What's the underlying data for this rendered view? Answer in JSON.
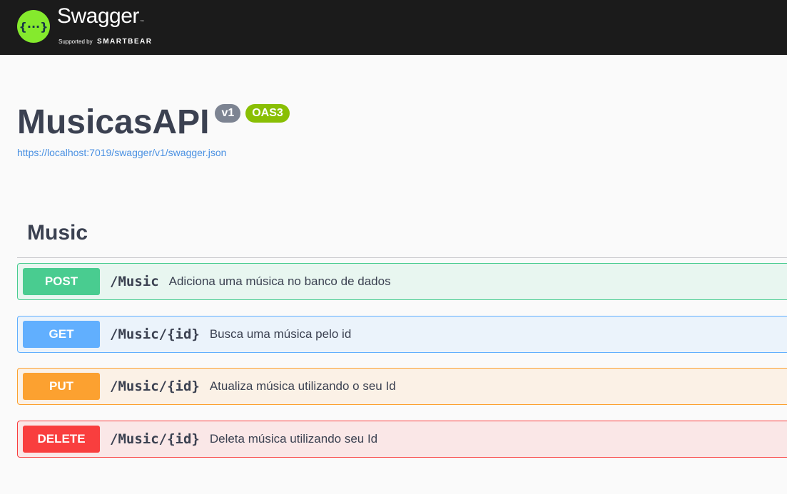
{
  "topbar": {
    "logo_name": "Swagger",
    "logo_tm": "™",
    "supported_by": "Supported by",
    "company": "SMARTBEAR",
    "logo_glyph": "{···}"
  },
  "info": {
    "title": "MusicasAPI",
    "version_badge": "v1",
    "oas_badge": "OAS3",
    "spec_url": "https://localhost:7019/swagger/v1/swagger.json"
  },
  "tag": {
    "name": "Music"
  },
  "operations": [
    {
      "method": "POST",
      "path": "/Music",
      "summary": "Adiciona uma música no banco de dados",
      "color": "#49cc90"
    },
    {
      "method": "GET",
      "path": "/Music/{id}",
      "summary": "Busca uma música pelo id",
      "color": "#61affe"
    },
    {
      "method": "PUT",
      "path": "/Music/{id}",
      "summary": "Atualiza música utilizando o seu Id",
      "color": "#fca130"
    },
    {
      "method": "DELETE",
      "path": "/Music/{id}",
      "summary": "Deleta música utilizando seu Id",
      "color": "#f93e3e"
    }
  ],
  "colors": {
    "topbar_bg": "#1b1b1b",
    "logo_green": "#85ea2d",
    "link": "#4990e2",
    "oas_badge": "#89bf04",
    "version_badge": "#7d8492"
  }
}
